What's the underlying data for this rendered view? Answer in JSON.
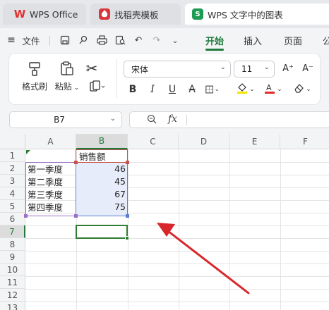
{
  "tabs": [
    {
      "label": "WPS Office",
      "icon": "wps-logo-icon"
    },
    {
      "label": "找稻壳模板",
      "icon": "daoke-template-icon"
    },
    {
      "label": "WPS 文字中的图表",
      "icon": "spreadsheet-s-icon",
      "icon_text": "S"
    }
  ],
  "menu": {
    "file_label": "文件",
    "tabs": [
      "开始",
      "插入",
      "页面",
      "公"
    ],
    "active_tab": "开始"
  },
  "ribbon": {
    "format_painter": "格式刷",
    "paste": "粘贴",
    "font_name": "宋体",
    "font_size": "11",
    "bold": "B",
    "italic": "I",
    "underline": "U",
    "strike": "A",
    "grow_font": "A⁺",
    "shrink_font": "A⁻"
  },
  "formula_bar": {
    "cell_ref": "B7",
    "fx": "fx",
    "content": ""
  },
  "sheet": {
    "columns": [
      "A",
      "B",
      "C",
      "D",
      "E",
      "F"
    ],
    "rows": [
      "1",
      "2",
      "3",
      "4",
      "5",
      "6",
      "7",
      "8",
      "9",
      "10",
      "11",
      "12",
      "13"
    ],
    "header_cell": "销售额",
    "data": [
      {
        "label": "第一季度",
        "value": "46"
      },
      {
        "label": "第二季度",
        "value": "45"
      },
      {
        "label": "第三季度",
        "value": "67"
      },
      {
        "label": "第四季度",
        "value": "75"
      }
    ],
    "selected_cell": "B7"
  },
  "colors": {
    "accent_green": "#1f7a3c",
    "annotation_red": "#d9262a",
    "range_blue": "#5a7fd6",
    "range_purple": "#9b6fc6",
    "range_red": "#c9514c"
  }
}
